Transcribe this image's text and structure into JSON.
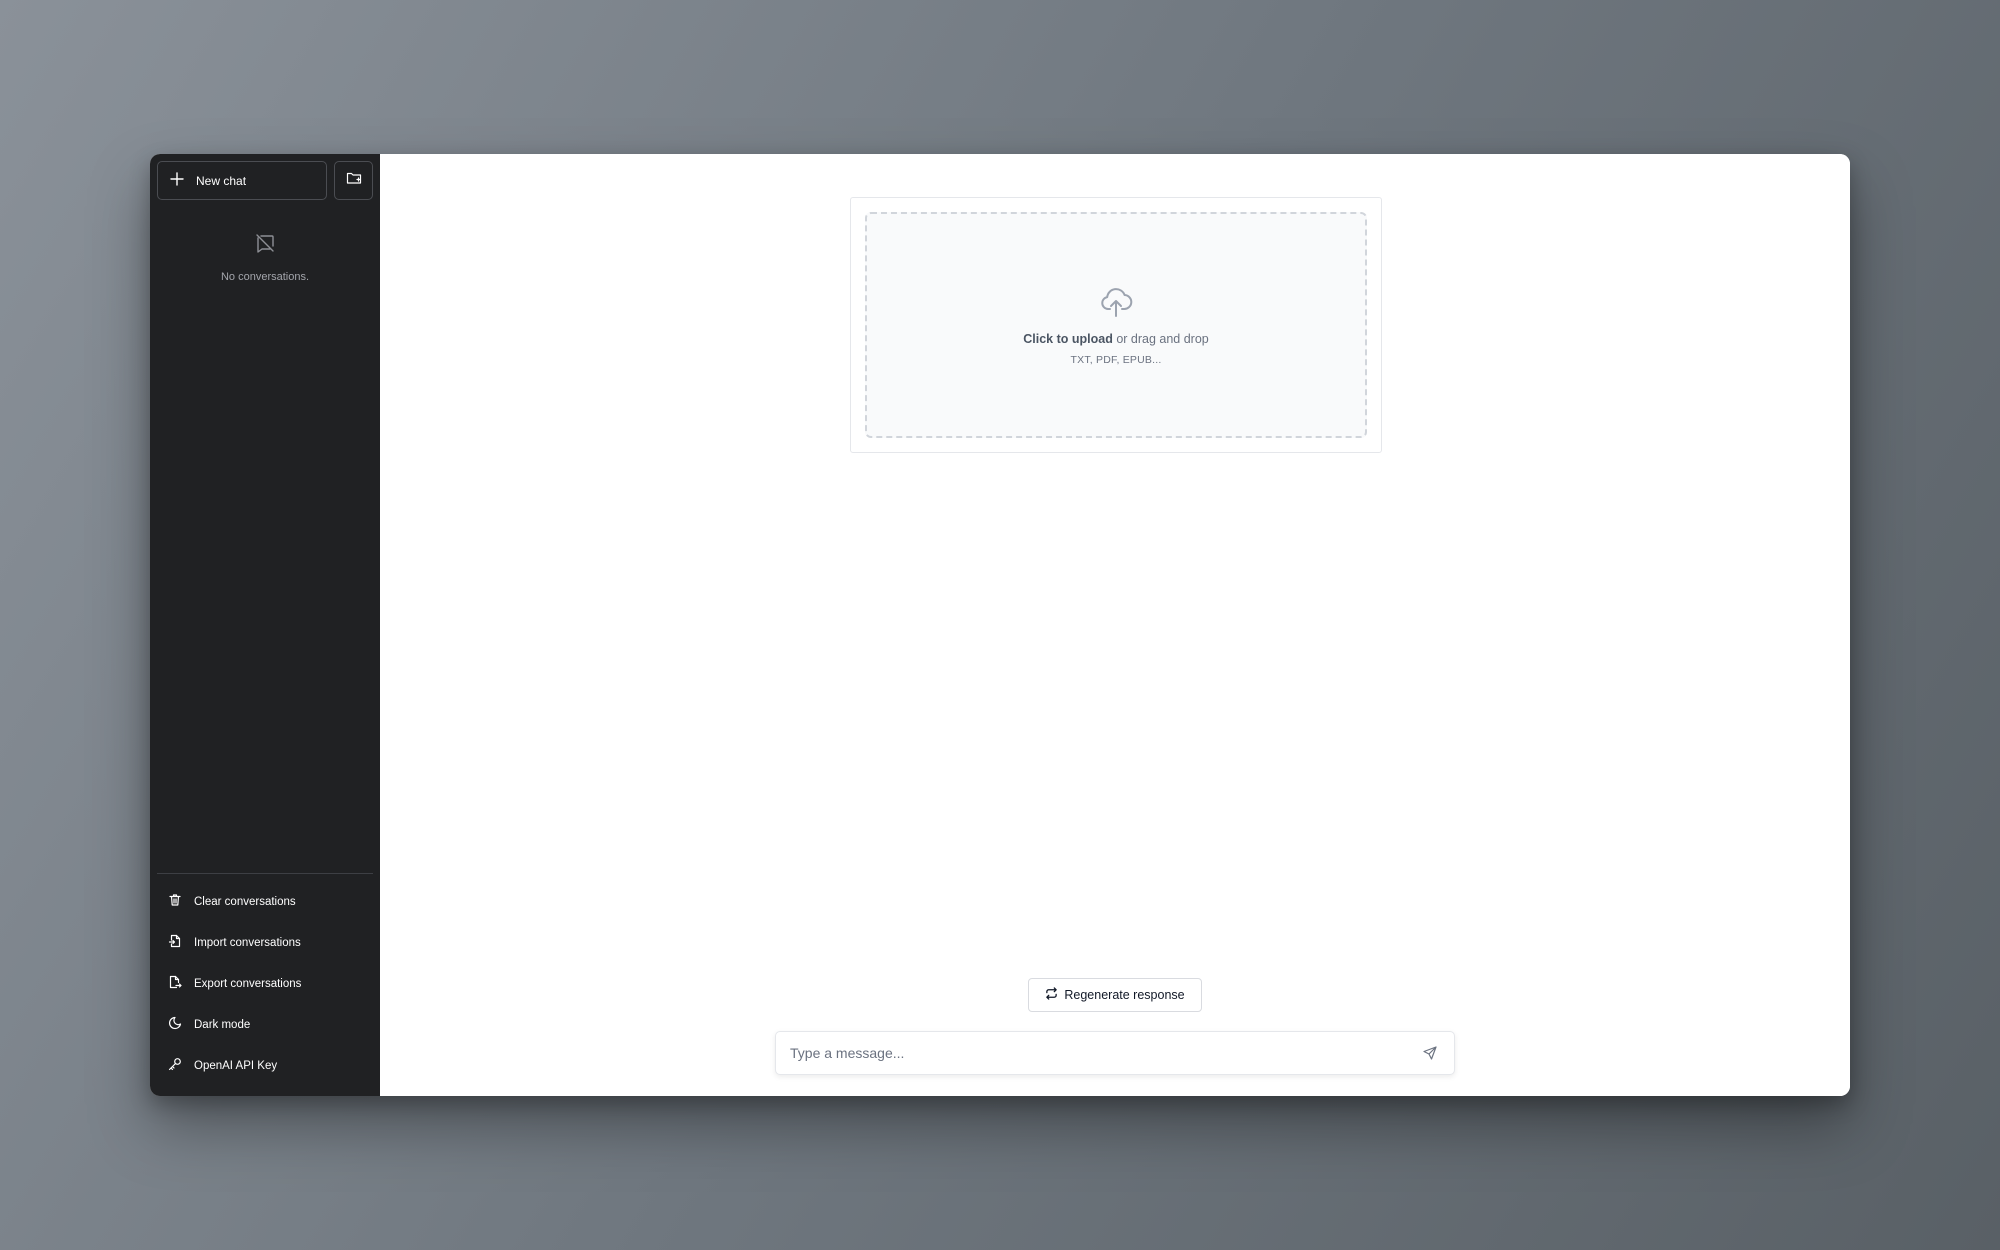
{
  "sidebar": {
    "new_chat_label": "New chat",
    "empty_text": "No conversations.",
    "items": [
      {
        "label": "Clear conversations",
        "icon": "trash-icon"
      },
      {
        "label": "Import conversations",
        "icon": "file-import-icon"
      },
      {
        "label": "Export conversations",
        "icon": "file-export-icon"
      },
      {
        "label": "Dark mode",
        "icon": "moon-icon"
      },
      {
        "label": "OpenAI API Key",
        "icon": "key-icon"
      }
    ]
  },
  "upload": {
    "click_text": "Click to upload",
    "rest_text": " or drag and drop",
    "formats": "TXT, PDF, EPUB..."
  },
  "chat": {
    "regenerate_label": "Regenerate response",
    "input_placeholder": "Type a message..."
  },
  "colors": {
    "sidebar_bg": "#202123",
    "main_bg": "#ffffff",
    "accent_border": "#4b4d52"
  }
}
